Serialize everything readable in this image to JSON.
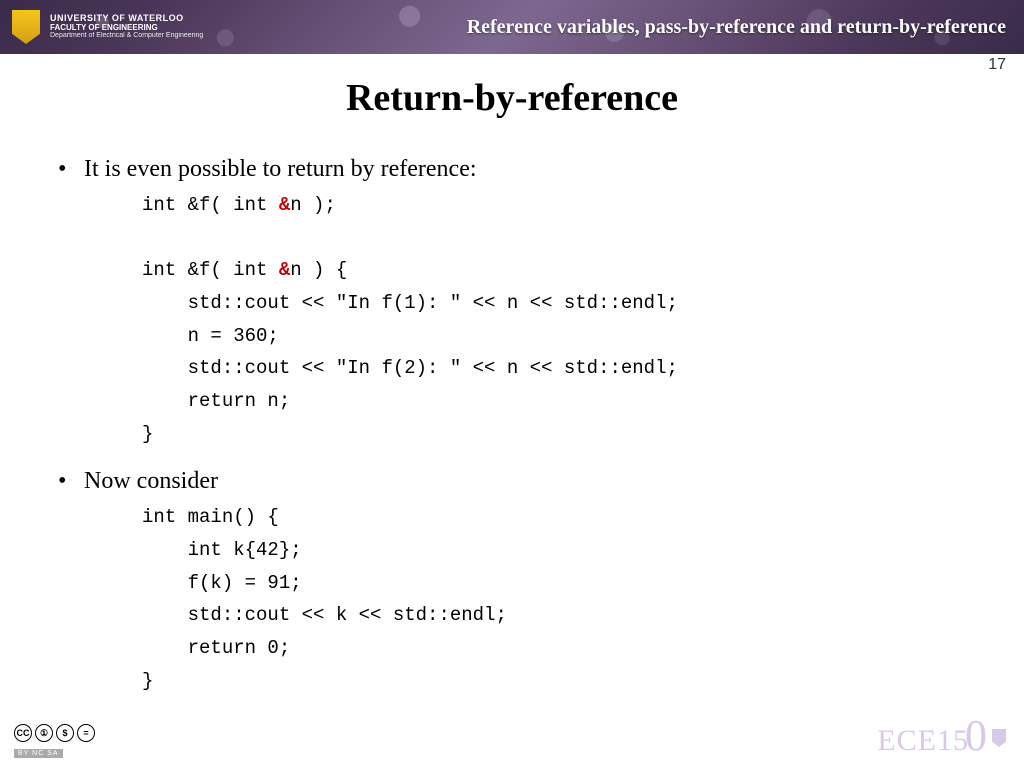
{
  "header": {
    "institution_line1": "UNIVERSITY OF WATERLOO",
    "institution_line2": "FACULTY OF ENGINEERING",
    "institution_line3": "Department of Electrical & Computer Engineering",
    "topic": "Reference variables, pass-by-reference and return-by-reference"
  },
  "page_number": "17",
  "title": "Return-by-reference",
  "bullets": {
    "b1": "It is even possible to return by reference:",
    "b2": "Now consider"
  },
  "code1": {
    "l1a": "int &f( int ",
    "l1amp": "&",
    "l1b": "n );",
    "blank": "",
    "l2a": "int &f( int ",
    "l2amp": "&",
    "l2b": "n ) {",
    "l3": "    std::cout << \"In f(1): \" << n << std::endl;",
    "l4": "    n = 360;",
    "l5": "    std::cout << \"In f(2): \" << n << std::endl;",
    "l6": "    return n;",
    "l7": "}"
  },
  "code2": {
    "l1": "int main() {",
    "l2": "    int k{42};",
    "l3": "    f(k) = 91;",
    "l4": "    std::cout << k << std::endl;",
    "l5": "    return 0;",
    "l6": "}"
  },
  "footer": {
    "cc": [
      "CC",
      "①",
      "$",
      "="
    ],
    "cc_label": "BY  NC  SA",
    "course_code": "ECE15",
    "course_big": "0"
  }
}
